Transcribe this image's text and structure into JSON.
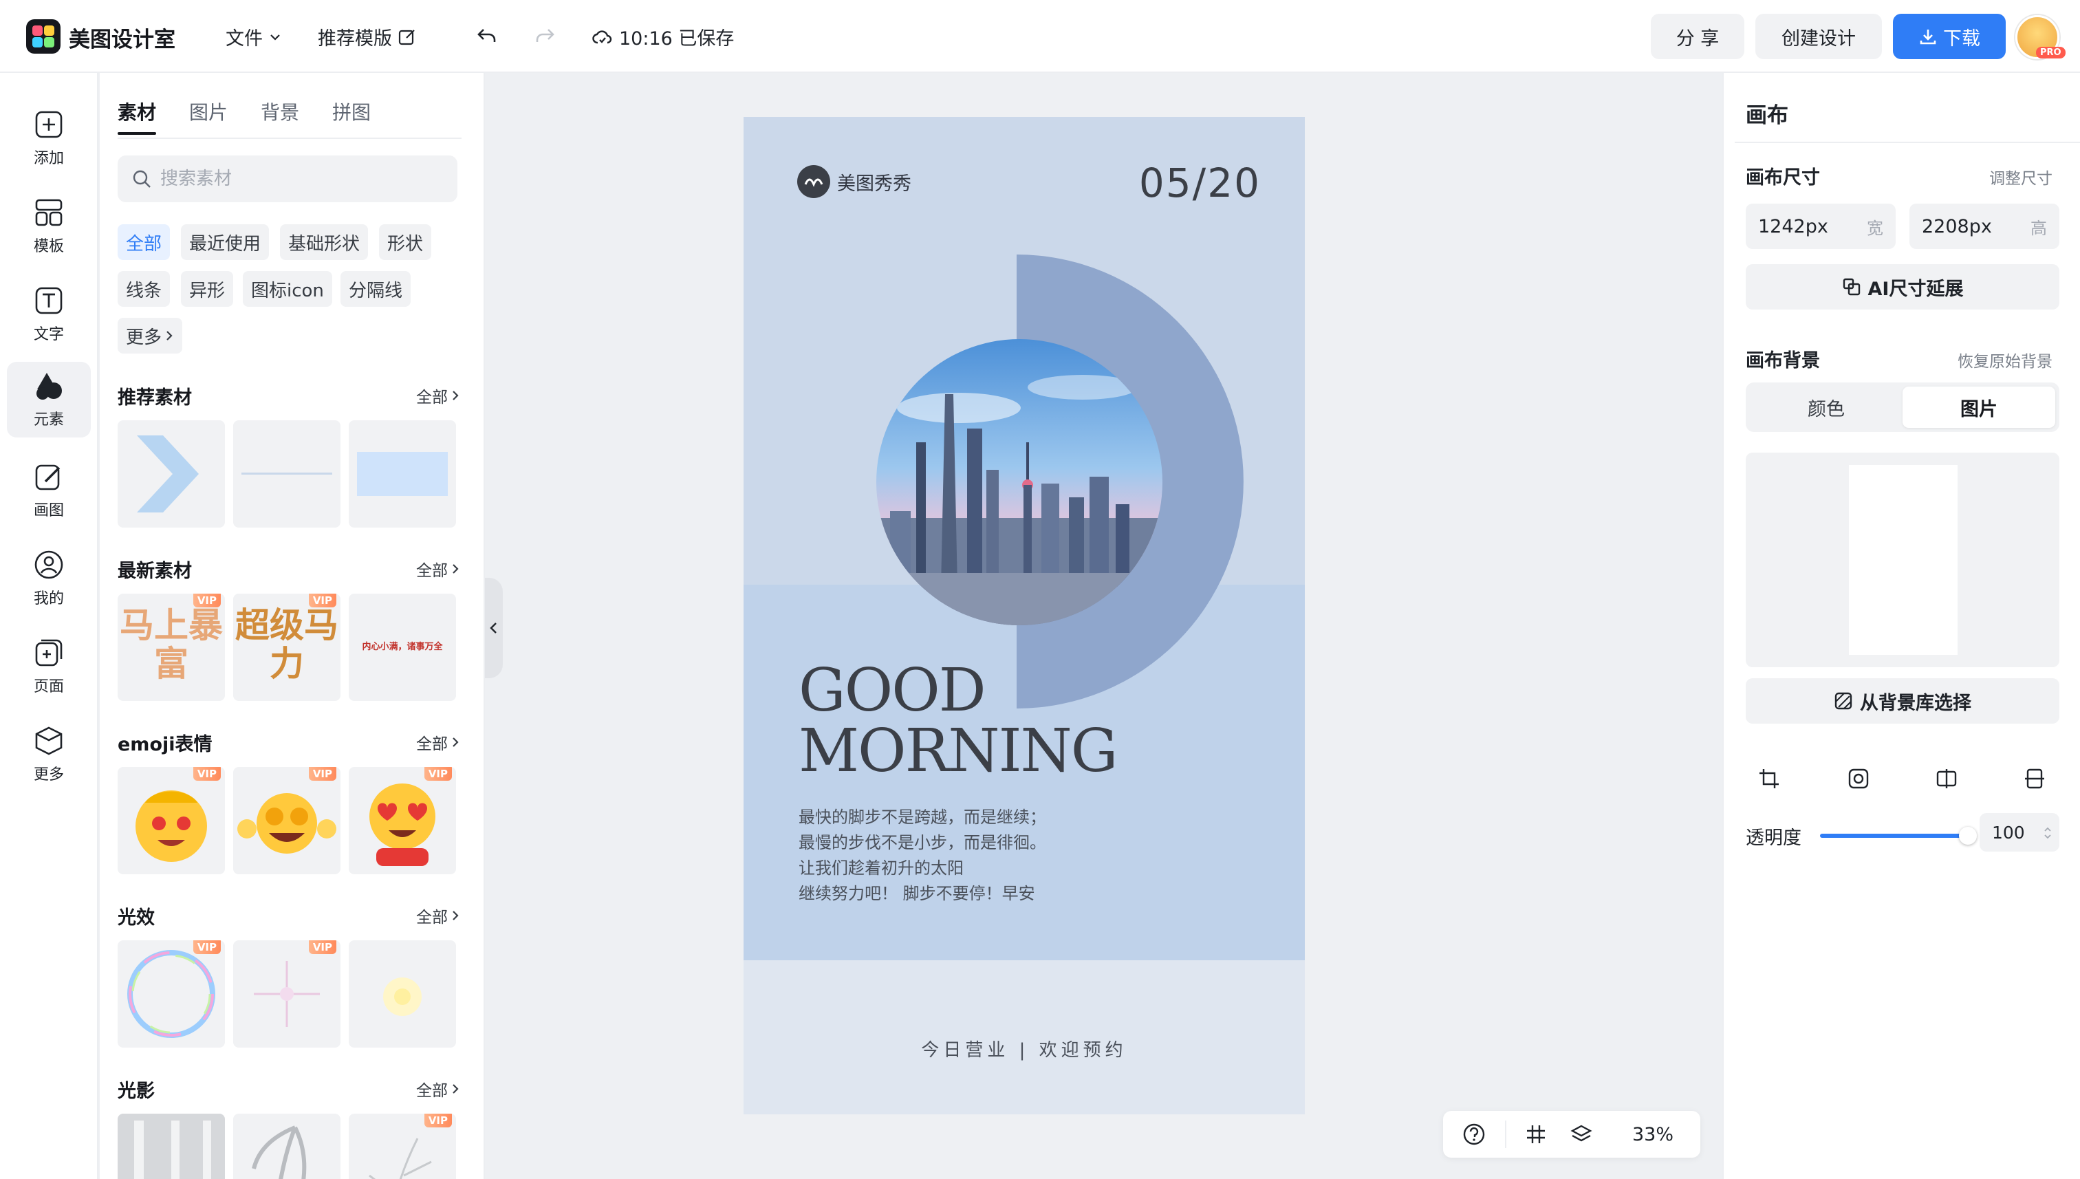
{
  "app": {
    "title": "美图设计室",
    "menu_file": "文件",
    "menu_templates": "推荐模版",
    "save_status": "10:16 已保存",
    "share_label": "分 享",
    "create_label": "创建设计",
    "download_label": "下载",
    "pro_badge": "PRO"
  },
  "leftnav": {
    "items": [
      {
        "label": "添加",
        "icon": "add-icon"
      },
      {
        "label": "模板",
        "icon": "template-icon"
      },
      {
        "label": "文字",
        "icon": "text-icon"
      },
      {
        "label": "元素",
        "icon": "shapes-icon"
      },
      {
        "label": "画图",
        "icon": "draw-icon"
      },
      {
        "label": "我的",
        "icon": "user-icon"
      },
      {
        "label": "页面",
        "icon": "page-icon"
      },
      {
        "label": "更多",
        "icon": "box-icon"
      }
    ],
    "active_index": 3
  },
  "assets": {
    "tabs": [
      "素材",
      "图片",
      "背景",
      "拼图"
    ],
    "search_placeholder": "搜索素材",
    "chips": [
      "全部",
      "最近使用",
      "基础形状",
      "形状",
      "线条",
      "异形",
      "图标icon",
      "分隔线",
      "更多"
    ],
    "view_all": "全部",
    "vip": "VIP",
    "sections": [
      {
        "title": "推荐素材"
      },
      {
        "title": "最新素材",
        "items": [
          "马上暴富",
          "超级马力",
          "内心小满，诸事万全"
        ]
      },
      {
        "title": "emoji表情"
      },
      {
        "title": "光效"
      },
      {
        "title": "光影"
      }
    ]
  },
  "poster": {
    "brand": "美图秀秀",
    "date": "05/20",
    "headline_1": "GOOD",
    "headline_2": "MORNING",
    "body": [
      "最快的脚步不是跨越，而是继续；",
      "最慢的步伐不是小步，而是徘徊。",
      "让我们趁着初升的太阳",
      "继续努力吧！ 脚步不要停！早安"
    ],
    "footer": "今日营业 | 欢迎预约"
  },
  "zoom": {
    "level": "33%"
  },
  "right_panel": {
    "title": "画布",
    "size_heading": "画布尺寸",
    "resize_link": "调整尺寸",
    "width_value": "1242px",
    "width_unit": "宽",
    "height_value": "2208px",
    "height_unit": "高",
    "ai_extend": "AI尺寸延展",
    "bg_heading": "画布背景",
    "restore_link": "恢复原始背景",
    "seg_color": "颜色",
    "seg_image": "图片",
    "from_library": "从背景库选择",
    "opacity_label": "透明度",
    "opacity_value": "100"
  },
  "colors": {
    "accent": "#2f7df6",
    "poster_ring": "#8fa6cc",
    "poster_mid": "#bfd2ea"
  }
}
